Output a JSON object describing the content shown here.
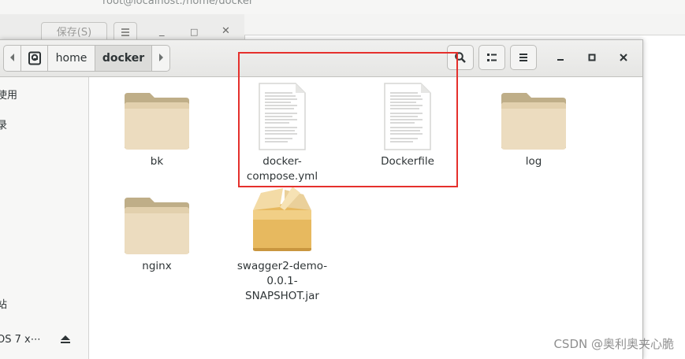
{
  "background_window": {
    "title": "root@localhost:/home/docker",
    "save_label": "保存(S)",
    "menu_icon": "hamburger-icon",
    "minimize": "_",
    "maximize": "□",
    "close": "✕"
  },
  "file_manager": {
    "pathbar": {
      "back_icon": "chevron-left-icon",
      "device_icon": "drive-icon",
      "crumbs": [
        "home",
        "docker"
      ],
      "forward_icon": "chevron-right-icon"
    },
    "toolbar": {
      "search_icon": "search-icon",
      "view_icon": "list-view-icon",
      "menu_icon": "hamburger-icon"
    },
    "window_controls": {
      "minimize": "—",
      "maximize": "□",
      "close": "✕"
    },
    "sidebar": {
      "items": [
        "使用",
        "录",
        "站",
        "OS 7 x⋯"
      ],
      "eject_icon": "eject-icon"
    },
    "files": [
      {
        "name": "bk",
        "type": "folder"
      },
      {
        "name": "docker-compose.yml",
        "type": "text"
      },
      {
        "name": "Dockerfile",
        "type": "text"
      },
      {
        "name": "log",
        "type": "folder"
      },
      {
        "name": "nginx",
        "type": "folder"
      },
      {
        "name": "swagger2-demo-0.0.1-SNAPSHOT.jar",
        "type": "package",
        "label_lines": [
          "swagger2-demo-",
          "0.0.1-SNAPSHOT.jar"
        ]
      }
    ],
    "highlight_color": "#e5302c"
  },
  "watermark": "CSDN @奥利奥夹心脆"
}
